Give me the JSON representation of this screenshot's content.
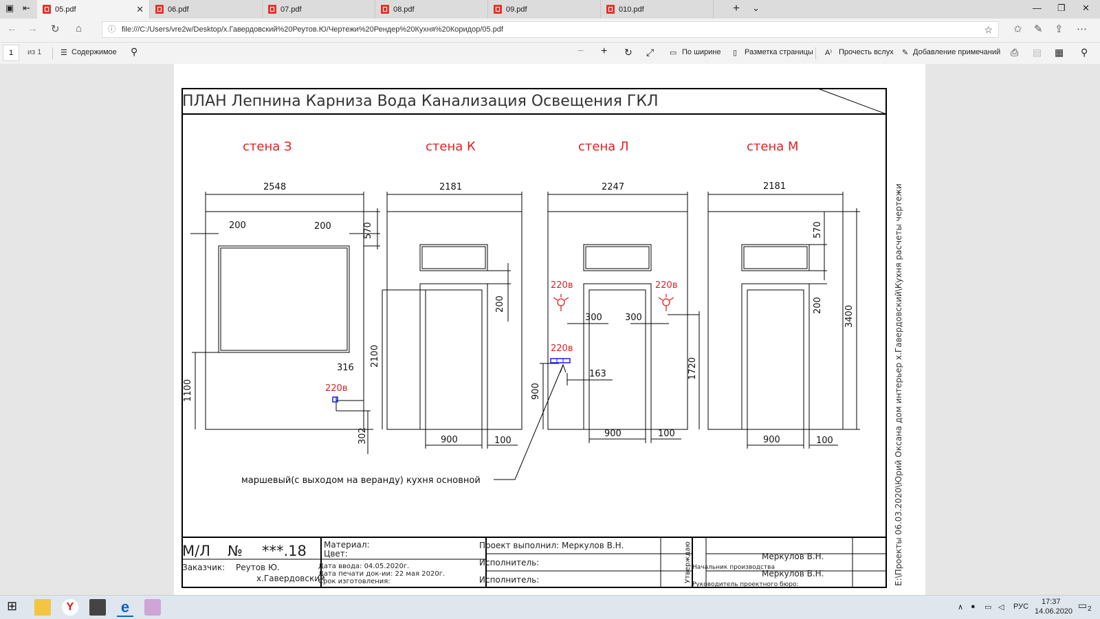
{
  "tabs": [
    {
      "label": "05.pdf",
      "active": true
    },
    {
      "label": "06.pdf"
    },
    {
      "label": "07.pdf"
    },
    {
      "label": "08.pdf"
    },
    {
      "label": "09.pdf"
    },
    {
      "label": "010.pdf"
    }
  ],
  "address": {
    "url": "file:///C:/Users/vre2w/Desktop/х.Гавердовский%20Реутов.Ю/Чертежи%20Рендер%20Кухня%20Коридор/05.pdf"
  },
  "pdf_toolbar": {
    "page_current": "1",
    "page_total": "из 1",
    "contents": "Содержимое",
    "fit_width": "По ширине",
    "page_layout": "Разметка страницы",
    "read_aloud": "Прочесть вслух",
    "add_notes": "Добавление примечаний"
  },
  "drawing": {
    "title": "ПЛАН   Лепнина  Карниза  Вода  Канализация  Освещения  ГКЛ",
    "walls": [
      "стена  З",
      "стена  К",
      "стена  Л",
      "стена  М"
    ],
    "dims": {
      "w1_width": "2548",
      "w1_200a": "200",
      "w1_200b": "200",
      "w1_570": "570",
      "w1_1100": "1100",
      "w1_316": "316",
      "w1_302": "302",
      "w1_220": "220в",
      "w2_width": "2181",
      "w2_2100": "2100",
      "w2_200": "200",
      "w2_900": "900",
      "w2_100": "100",
      "w3_width": "2247",
      "w3_220a": "220в",
      "w3_220b": "220в",
      "w3_220c": "220в",
      "w3_300a": "300",
      "w3_300b": "300",
      "w3_163": "163",
      "w3_900v": "900",
      "w3_1720": "1720",
      "w3_900": "900",
      "w3_100": "100",
      "w4_width": "2181",
      "w4_570": "570",
      "w4_200": "200",
      "w4_3400": "3400",
      "w4_900": "900",
      "w4_100": "100"
    },
    "note": "маршевый(с выходом на веранду) кухня основной",
    "stamp": {
      "code_prefix": "М/Л",
      "code_no": "№",
      "code_num": "***.18",
      "material": "Материал:",
      "color": "Цвет:",
      "customer_label": "Заказчик:",
      "customer_name": "Реутов Ю.",
      "customer_place": "х.Гавердовский",
      "date_in": "Дата ввода: 04.05.2020г.",
      "date_print": "Дата печати док-ии: 22 мая 2020г.",
      "deadline": "Срок изготовления:",
      "done_by": "Проект выполнил: Меркулов В.Н.",
      "executor1": "Исполнитель:",
      "executor2": "Исполнитель:",
      "approved": "Утверждаю",
      "sign1_name": "Меркулов В.Н.",
      "sign1_role": "Начальник производства",
      "sign2_name": "Меркулов В.Н.",
      "sign2_role": "Руководитель проектного бюро:"
    },
    "side_path": "E:\\Проекты 06.03.2020\\Юрий Оксана дом интерьер х.Гавердовский\\Кухня расчеты чертежи"
  },
  "tray": {
    "lang": "РУС",
    "time": "17:37",
    "date": "14.06.2020",
    "notif": "2"
  }
}
